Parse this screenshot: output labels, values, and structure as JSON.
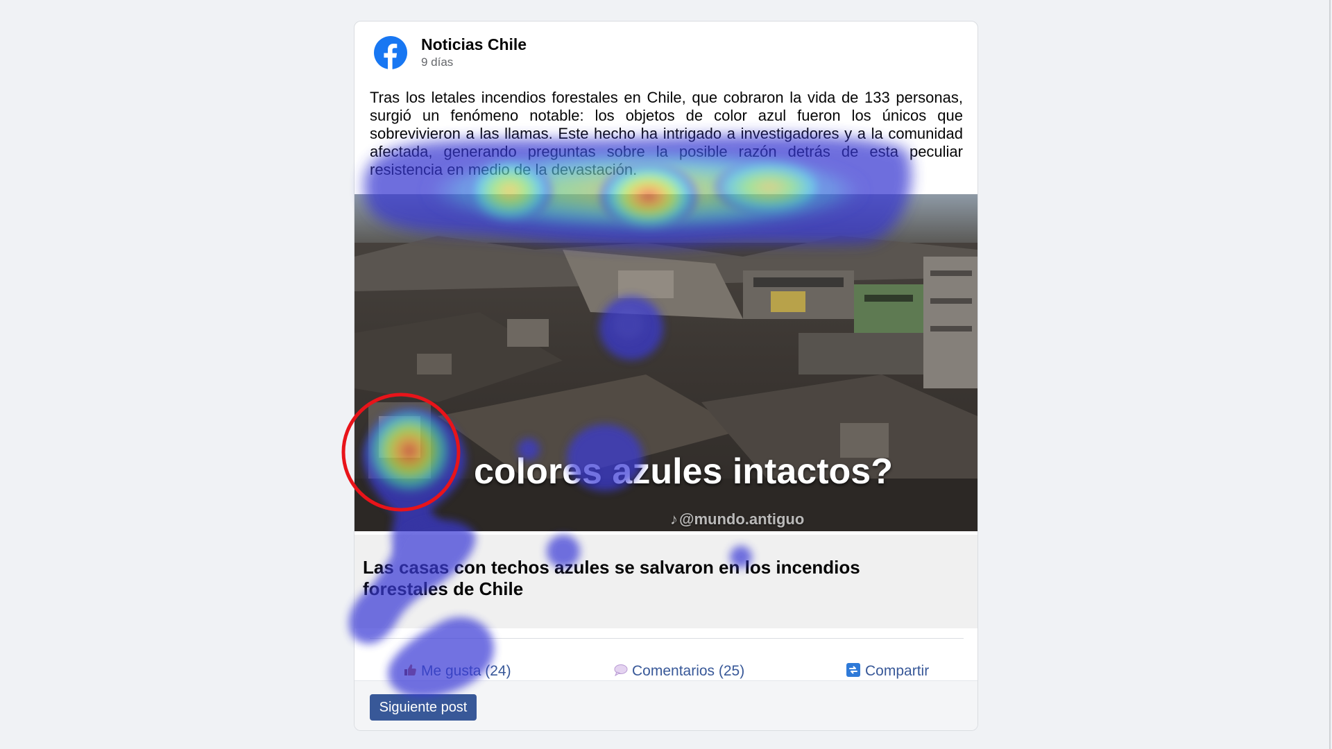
{
  "post": {
    "page_name": "Noticias Chile",
    "age": "9 días",
    "logo_icon": "facebook-logo-icon",
    "text": "Tras los letales incendios forestales en Chile, que cobraron la vida de 133 personas, surgió un fenómeno notable: los objetos de color azul fueron los únicos que sobrevivieron a las llamas. Este hecho ha intrigado a investigadores y a la comunidad afectada, generando preguntas sobre la posible razón detrás de esta peculiar resistencia en medio de la devastación."
  },
  "media": {
    "overlay_text": "colores azules intactos?",
    "watermark_icon": "tiktok-icon",
    "watermark": "@mundo.antiguo"
  },
  "link": {
    "title": "Las casas con techos azules se salvaron en los incendios forestales de Chile"
  },
  "actions": {
    "like_label": "Me gusta (24)",
    "like_icon": "thumbs-up-icon",
    "comments_label": "Comentarios (25)",
    "comments_icon": "speech-bubble-icon",
    "share_label": "Compartir",
    "share_icon": "share-icon"
  },
  "footer": {
    "next_label": "Siguiente post"
  },
  "colors": {
    "facebook_blue": "#1877f2",
    "link_blue": "#385898",
    "button_blue": "#385898",
    "highlight_ring": "#e8141a"
  }
}
